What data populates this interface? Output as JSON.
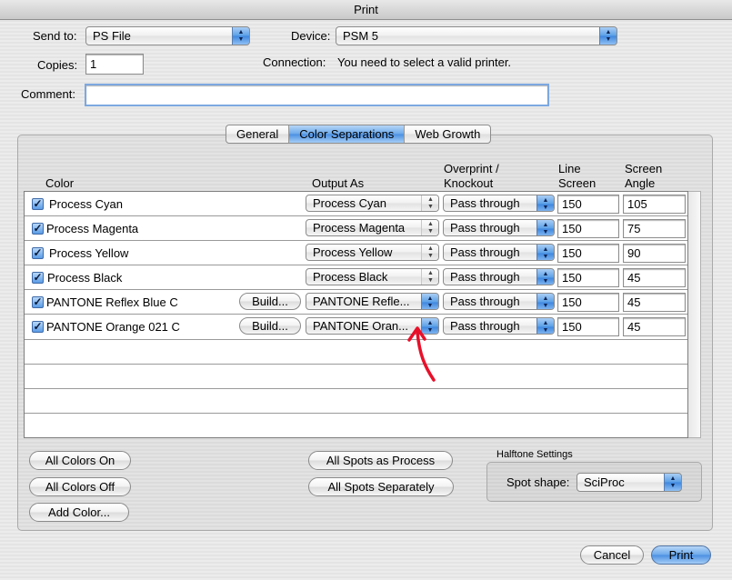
{
  "window": {
    "title": "Print"
  },
  "send_to": {
    "label": "Send to:",
    "value": "PS File"
  },
  "device": {
    "label": "Device:",
    "value": "PSM 5"
  },
  "copies": {
    "label": "Copies:",
    "value": "1"
  },
  "connection": {
    "label": "Connection:",
    "value": "You need to select a valid printer."
  },
  "comment": {
    "label": "Comment:",
    "value": ""
  },
  "tabs": [
    {
      "label": "General",
      "selected": false
    },
    {
      "label": "Color Separations",
      "selected": true
    },
    {
      "label": "Web Growth",
      "selected": false
    }
  ],
  "columns": {
    "color": "Color",
    "output_as": "Output As",
    "overprint_1": "Overprint /",
    "overprint_2": "Knockout",
    "line_1": "Line",
    "line_2": "Screen",
    "angle_1": "Screen",
    "angle_2": "Angle"
  },
  "rows": [
    {
      "checked": true,
      "name": "Process Cyan",
      "build": "",
      "output": "Process Cyan",
      "overprint": "Pass through",
      "line": "150",
      "angle": "105"
    },
    {
      "checked": true,
      "name": "Process Magenta",
      "build": "",
      "output": "Process Magenta",
      "overprint": "Pass through",
      "line": "150",
      "angle": "75"
    },
    {
      "checked": true,
      "name": "Process Yellow",
      "build": "",
      "output": "Process Yellow",
      "overprint": "Pass through",
      "line": "150",
      "angle": "90"
    },
    {
      "checked": true,
      "name": "Process Black",
      "build": "",
      "output": "Process Black",
      "overprint": "Pass through",
      "line": "150",
      "angle": "45"
    },
    {
      "checked": true,
      "name": "PANTONE Reflex Blue C",
      "build": "Build...",
      "output": "PANTONE Refle...",
      "overprint": "Pass through",
      "line": "150",
      "angle": "45"
    },
    {
      "checked": true,
      "name": "PANTONE Orange 021 C",
      "build": "Build...",
      "output": "PANTONE Oran...",
      "overprint": "Pass through",
      "line": "150",
      "angle": "45"
    }
  ],
  "buttons": {
    "all_colors_on": "All Colors On",
    "all_colors_off": "All Colors Off",
    "add_color": "Add Color...",
    "all_spots_process": "All Spots as Process",
    "all_spots_separately": "All Spots Separately",
    "cancel": "Cancel",
    "print": "Print"
  },
  "halftone": {
    "title": "Halftone Settings",
    "spot_shape_label": "Spot shape:",
    "spot_shape_value": "SciProc"
  },
  "colors": {
    "accent": "#5a9fe6",
    "annotation_arrow": "#e8102a"
  },
  "icons": {
    "popup": "up-down-arrows-icon",
    "checkbox": "checkmark-icon",
    "annotation": "red-arrow-icon"
  }
}
